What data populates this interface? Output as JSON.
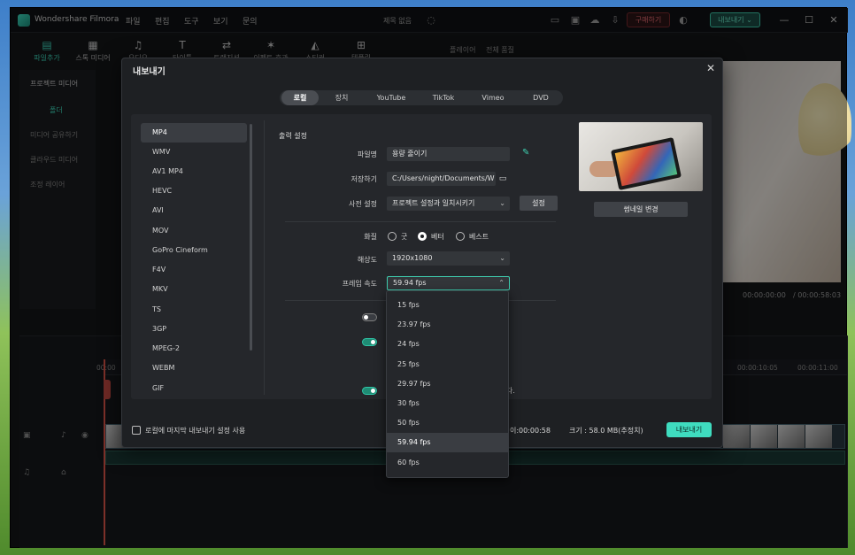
{
  "titlebar": {
    "app_name": "Wondershare Filmora",
    "menu": [
      "파일",
      "편집",
      "도구",
      "보기",
      "문의"
    ],
    "doc_title": "제목 없음",
    "buy_label": "구매하기",
    "export_label": "내보내기"
  },
  "toolbar": {
    "items": [
      "파일추가",
      "스톡 미디어",
      "오디오",
      "타이틀",
      "트랜지션",
      "이펙트 효과",
      "스티커",
      "템플릿"
    ]
  },
  "left_panel": {
    "items": [
      "프로젝트 미디어",
      "폴더",
      "미디어 공유하기",
      "클라우드 미디어",
      "조정 레이어"
    ]
  },
  "player": {
    "label": "플레이어",
    "quality": "전체 품질",
    "time_current": "00:00:00:00",
    "time_total": "/ 00:00:58:03"
  },
  "timeline": {
    "ruler": [
      "00:00",
      "00:00:10:05",
      "00:00:11:00"
    ]
  },
  "dialog": {
    "title": "내보내기",
    "tabs": [
      "로컬",
      "장치",
      "YouTube",
      "TikTok",
      "Vimeo",
      "DVD"
    ],
    "formats": [
      "MP4",
      "WMV",
      "AV1 MP4",
      "HEVC",
      "AVI",
      "MOV",
      "GoPro Cineform",
      "F4V",
      "MKV",
      "TS",
      "3GP",
      "MPEG-2",
      "WEBM",
      "GIF"
    ],
    "section_title": "출력 설정",
    "filename_label": "파일명",
    "filename_value": "용량 줄이기",
    "save_label": "저장하기",
    "save_path": "C:/Users/night/Documents/W",
    "preset_label": "사전 설정",
    "preset_value": "프로젝트 설정과 일치시키기",
    "preset_button": "설정",
    "quality_label": "화질",
    "quality_options": [
      "굿",
      "베터",
      "베스트"
    ],
    "resolution_label": "해상도",
    "resolution_value": "1920x1080",
    "framerate_label": "프레임 속도",
    "framerate_value": "59.94 fps",
    "hidden_text_tail": "다.",
    "thumbnail_button": "썸네일 변경",
    "footer_checkbox": "로컬에 마지막 내보내기 설정 사용",
    "footer_time": "이:00:00:58",
    "footer_size": "크기 : 58.0 MB(추정치)",
    "export_button": "내보내기"
  },
  "dropdown": {
    "options": [
      "15 fps",
      "23.97 fps",
      "24 fps",
      "25 fps",
      "29.97 fps",
      "30 fps",
      "50 fps",
      "59.94 fps",
      "60 fps"
    ]
  },
  "colors": {
    "accent": "#3fdcbf",
    "buy": "#ef6d74",
    "background": "#141619"
  }
}
